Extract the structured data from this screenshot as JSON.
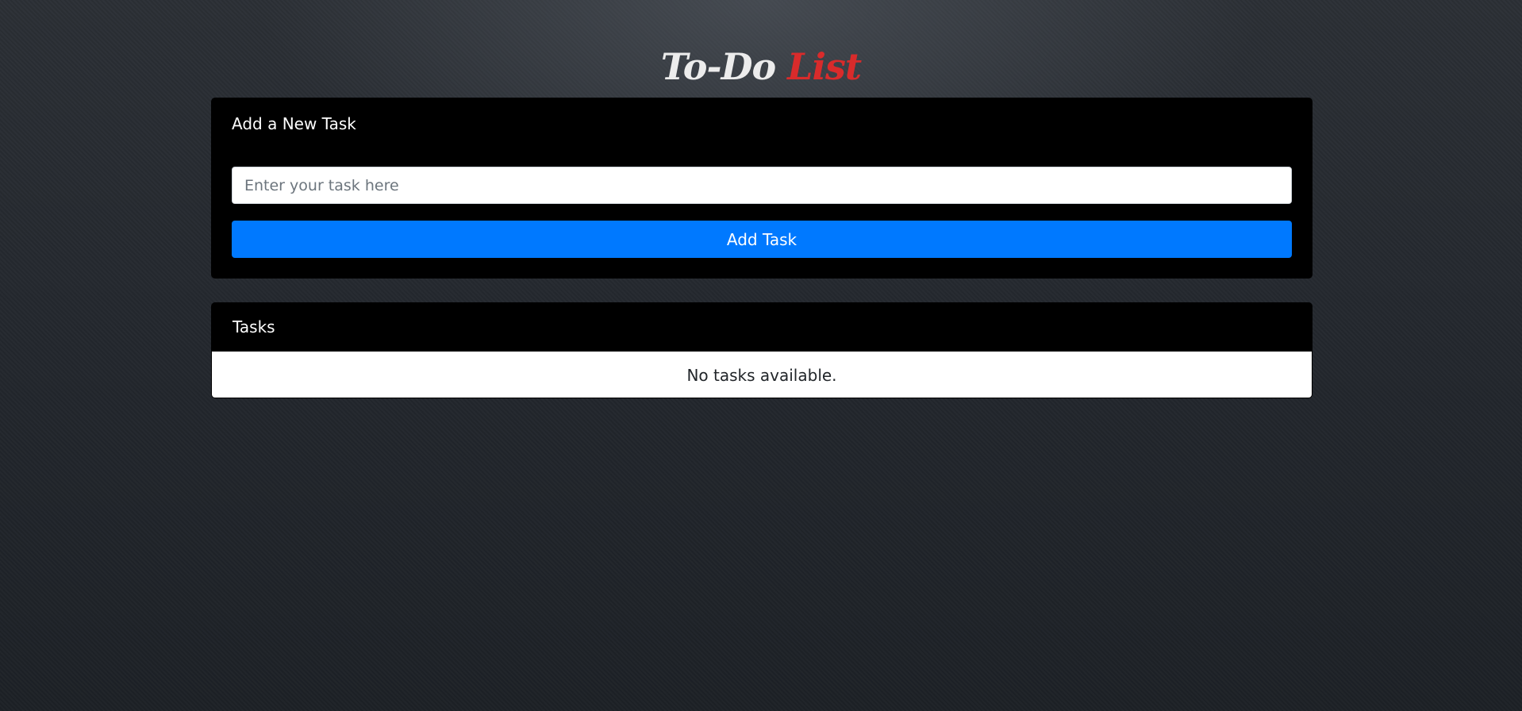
{
  "header": {
    "title_main": "To-Do",
    "title_accent": "List"
  },
  "add_task": {
    "heading": "Add a New Task",
    "input_value": "",
    "input_placeholder": "Enter your task here",
    "button_label": "Add Task"
  },
  "tasks": {
    "heading": "Tasks",
    "empty_message": "No tasks available."
  },
  "colors": {
    "accent_red": "#d92b2b",
    "button_blue": "#0079ff",
    "card_bg": "#000000"
  }
}
